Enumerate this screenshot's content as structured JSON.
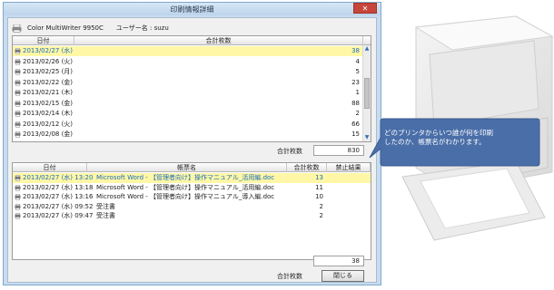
{
  "window": {
    "title": "印刷情報詳細",
    "close_glyph": "✕"
  },
  "header": {
    "printer_name": "Color MultiWriter 9950C",
    "user_label": "ユーザー名 : suzu"
  },
  "daily_table": {
    "columns": [
      "日付",
      "合計枚数"
    ],
    "rows": [
      {
        "date": "2013/02/27 (水)",
        "count": "38",
        "selected": true
      },
      {
        "date": "2013/02/26 (火)",
        "count": "4"
      },
      {
        "date": "2013/02/25 (月)",
        "count": "5"
      },
      {
        "date": "2013/02/22 (金)",
        "count": "23"
      },
      {
        "date": "2013/02/21 (木)",
        "count": "1"
      },
      {
        "date": "2013/02/15 (金)",
        "count": "88"
      },
      {
        "date": "2013/02/14 (木)",
        "count": "2"
      },
      {
        "date": "2013/02/12 (火)",
        "count": "66"
      },
      {
        "date": "2013/02/08 (金)",
        "count": "15"
      }
    ],
    "total_label": "合計枚数",
    "total_value": "830"
  },
  "job_table": {
    "columns": [
      "日付",
      "帳票名",
      "合計枚数",
      "禁止結果"
    ],
    "rows": [
      {
        "datetime": "2013/02/27 (水) 13:20",
        "document": "Microsoft Word - 【管理者向け】操作マニュアル_活用編.doc",
        "count": "13",
        "result": "",
        "selected": true
      },
      {
        "datetime": "2013/02/27 (水) 13:18",
        "document": "Microsoft Word - 【管理者向け】操作マニュアル_活用編.doc",
        "count": "11",
        "result": ""
      },
      {
        "datetime": "2013/02/27 (水) 13:16",
        "document": "Microsoft Word - 【管理者向け】操作マニュアル_導入編.doc",
        "count": "10",
        "result": ""
      },
      {
        "datetime": "2013/02/27 (水) 09:52",
        "document": "受注書",
        "count": "2",
        "result": ""
      },
      {
        "datetime": "2013/02/27 (水) 09:47",
        "document": "受注書",
        "count": "2",
        "result": ""
      }
    ],
    "total_label": "合計枚数",
    "total_value": "38"
  },
  "close_button_label": "閉じる",
  "callout": {
    "line1": "どのプリンタからいつ誰が何を印刷",
    "line2": "したのか、帳票名がわかります。"
  },
  "colors": {
    "selection": "#fff7a6",
    "selection_text": "#1a6cbf",
    "callout": "#4a6ea8",
    "titlebar": "#c8dcf0"
  }
}
